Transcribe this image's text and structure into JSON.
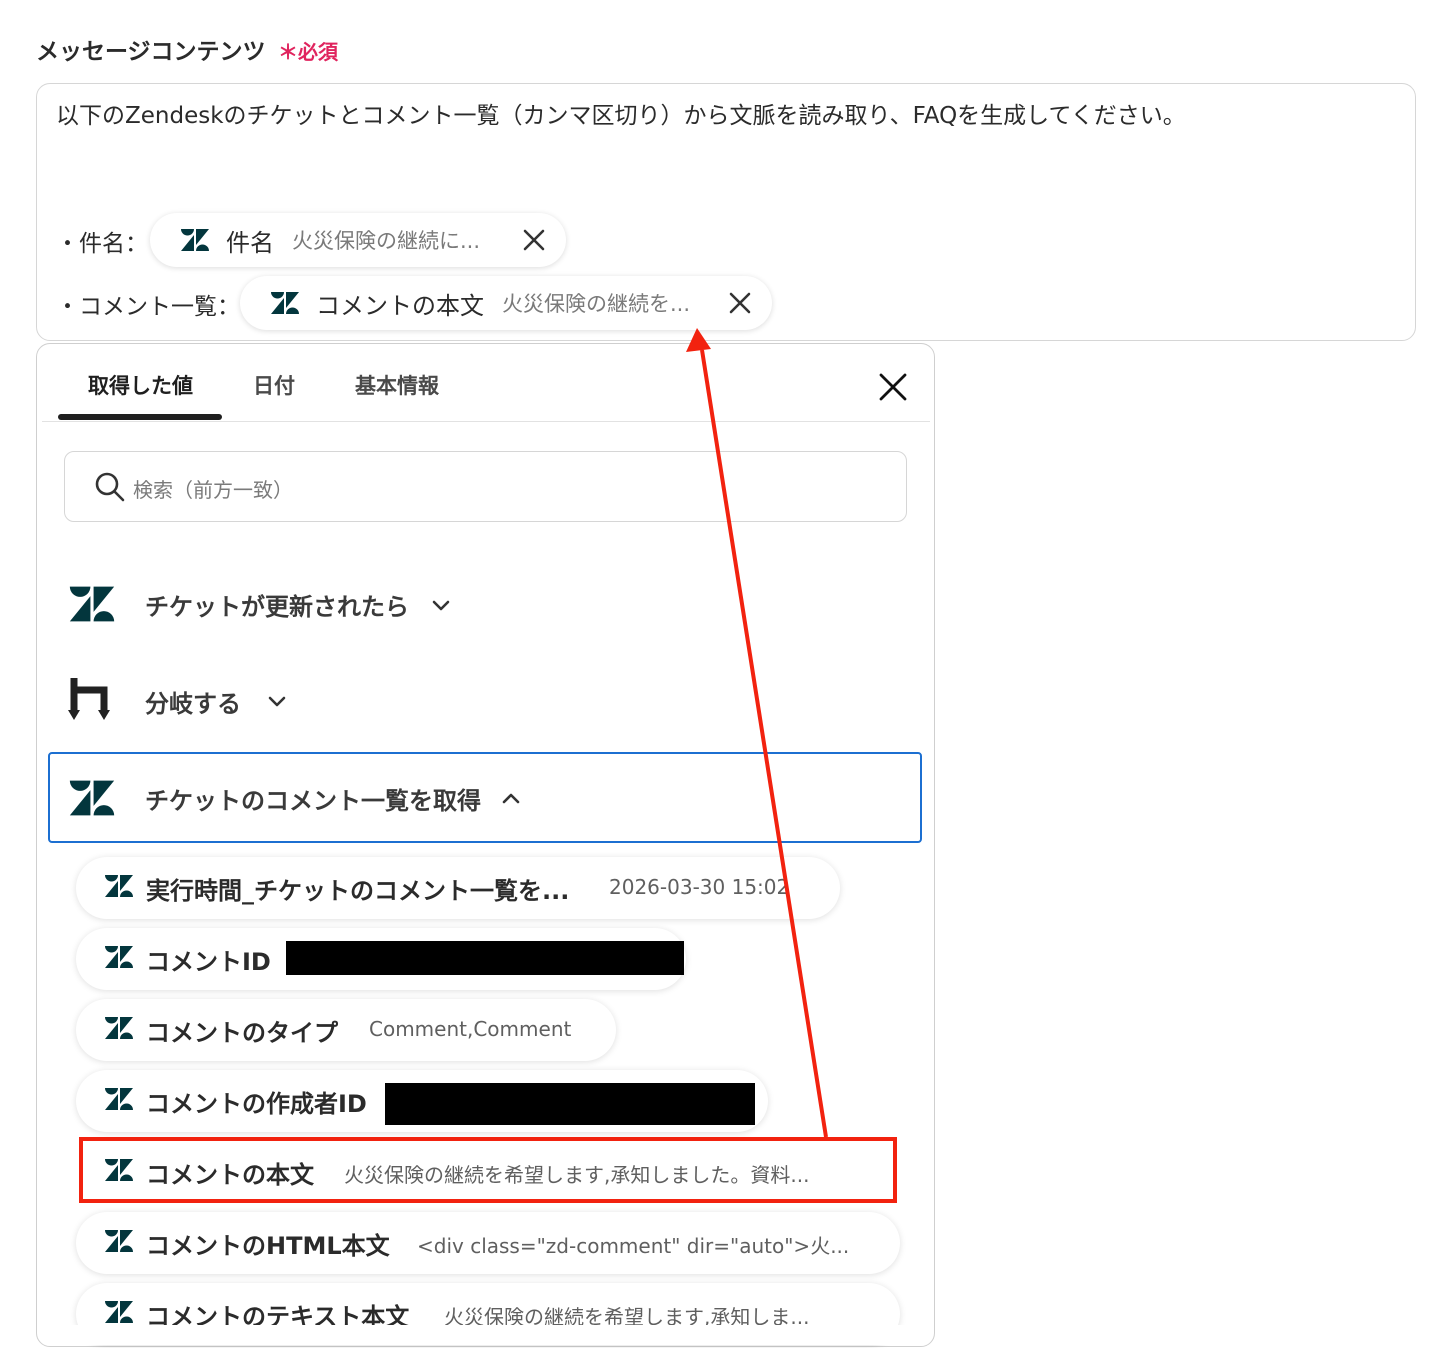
{
  "field": {
    "label": "メッセージコンテンツ",
    "required_mark": "＊必須",
    "message_text": "以下のZendeskのチケットとコメント一覧（カンマ区切り）から文脈を読み取り、FAQを生成してください。",
    "lines": [
      {
        "label": "・件名：",
        "chip_name": "件名",
        "chip_value": "火災保険の継続に..."
      },
      {
        "label": "・コメント一覧：",
        "chip_name": "コメントの本文",
        "chip_value": "火災保険の継続を..."
      }
    ]
  },
  "panel": {
    "tabs": [
      {
        "label": "取得した値",
        "active": true
      },
      {
        "label": "日付",
        "active": false
      },
      {
        "label": "基本情報",
        "active": false
      }
    ],
    "search_placeholder": "検索（前方一致）",
    "groups": [
      {
        "title": "チケットが更新されたら",
        "icon": "zendesk-icon",
        "expanded": false
      },
      {
        "title": "分岐する",
        "icon": "branch-icon",
        "expanded": false
      },
      {
        "title": "チケットのコメント一覧を取得",
        "icon": "zendesk-icon",
        "expanded": true
      }
    ],
    "items": [
      {
        "name": "実行時間_チケットのコメント一覧を...",
        "value": "2026-03-30 15:02",
        "redacted": false
      },
      {
        "name": "コメントID",
        "value": "",
        "redacted": true
      },
      {
        "name": "コメントのタイプ",
        "value": "Comment,Comment",
        "redacted": false
      },
      {
        "name": "コメントの作成者ID",
        "value": "",
        "redacted": true
      },
      {
        "name": "コメントの本文",
        "value": "火災保険の継続を希望します,承知しました。資料...",
        "redacted": false,
        "highlighted": true
      },
      {
        "name": "コメントのHTML本文",
        "value": "<div class=\"zd-comment\" dir=\"auto\">火...",
        "redacted": false
      },
      {
        "name": "コメントのテキスト本文",
        "value": "火災保険の継続を希望します,承知しま...",
        "redacted": false
      }
    ]
  },
  "colors": {
    "zendesk_icon": "#03363d",
    "selection_border": "#1c6fd1",
    "annotation_red": "#f2220f",
    "required_red": "#e0245e"
  }
}
